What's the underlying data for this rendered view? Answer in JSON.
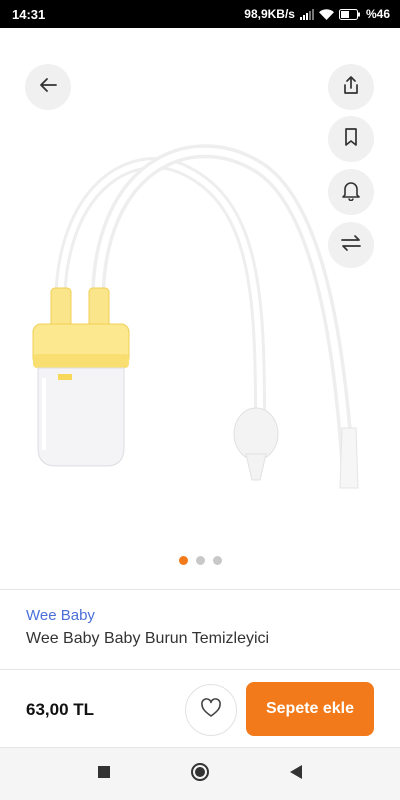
{
  "status_bar": {
    "time": "14:31",
    "network_speed": "98,9KB/s",
    "battery": "%46",
    "icons": [
      "signal-icon",
      "wifi-icon",
      "battery-icon"
    ]
  },
  "toolbar": {
    "icons": [
      "back-arrow-icon",
      "share-icon",
      "bookmark-icon",
      "bell-icon",
      "compare-arrows-icon"
    ]
  },
  "gallery": {
    "image_count": 3,
    "active_index": 0
  },
  "product": {
    "brand": "Wee Baby",
    "title": "Wee Baby Baby Burun Temizleyici",
    "price": "63,00 TL"
  },
  "actions": {
    "favorite_icon": "heart-icon",
    "add_to_cart": "Sepete ekle"
  },
  "nav_bar": {
    "icons": [
      "recent-apps-icon",
      "home-icon",
      "back-icon"
    ]
  },
  "colors": {
    "accent": "#f27a1a",
    "brand_link": "#4a6fd8",
    "status_bar": "#000000"
  }
}
